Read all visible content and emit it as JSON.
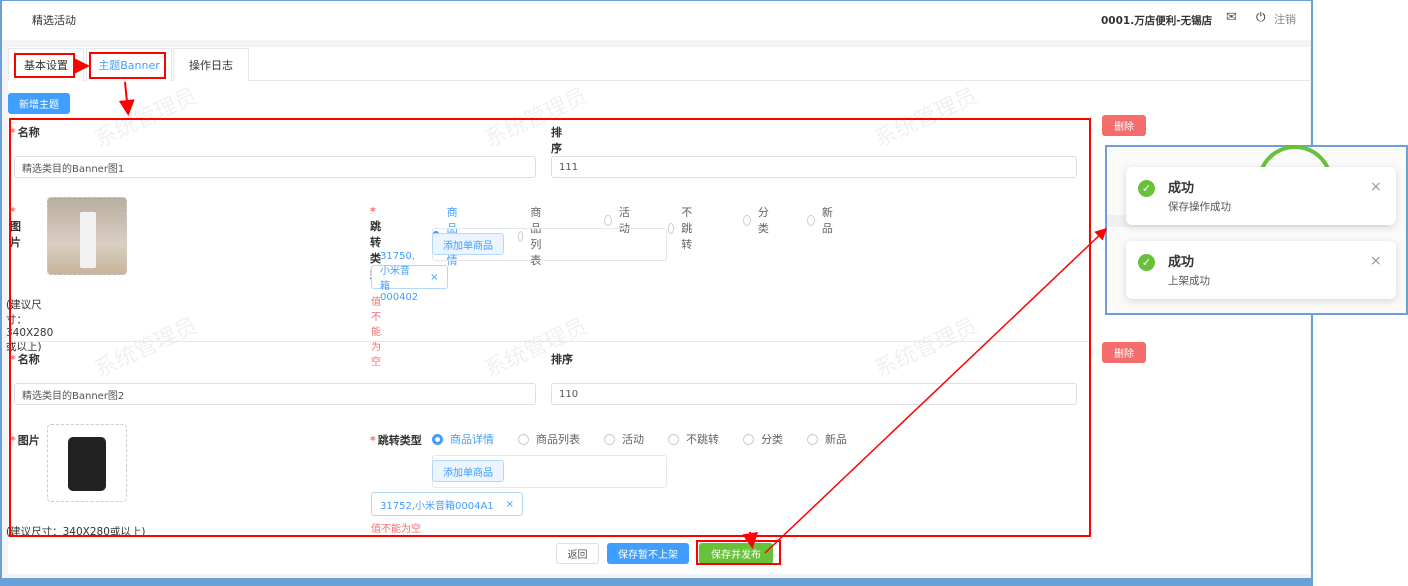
{
  "header": {
    "title": "精选活动",
    "store": "0001.万店便利-无锡店",
    "logout": "注销"
  },
  "tabs": [
    {
      "label": "基本设置"
    },
    {
      "label": "主题Banner"
    },
    {
      "label": "操作日志"
    }
  ],
  "add_theme": "新增主题",
  "watermark": "系统管理员",
  "themes": [
    {
      "name_label": "名称",
      "sort_label": "排序",
      "name_value": "精选类目的Banner图1",
      "sort_value": "111",
      "image_label": "图片",
      "size_hint": "(建议尺寸：340X280或以上)",
      "jump_label": "跳转类型",
      "options": [
        "商品详情",
        "商品列表",
        "活动",
        "不跳转",
        "分类",
        "新品"
      ],
      "selected": 0,
      "add_product": "添加单商品",
      "tag": "31750,小米音箱000402",
      "error": "值不能为空",
      "delete": "删除"
    },
    {
      "name_label": "名称",
      "sort_label": "排序",
      "name_value": "精选类目的Banner图2",
      "sort_value": "110",
      "image_label": "图片",
      "size_hint": "(建议尺寸：340X280或以上)",
      "jump_label": "跳转类型",
      "options": [
        "商品详情",
        "商品列表",
        "活动",
        "不跳转",
        "分类",
        "新品"
      ],
      "selected": 0,
      "add_product": "添加单商品",
      "tag": "31752,小米音箱0004A1",
      "error": "值不能为空",
      "delete": "删除"
    }
  ],
  "footer": {
    "back": "返回",
    "save_draft": "保存暂不上架",
    "save_publish": "保存并发布"
  },
  "toasts": [
    {
      "title": "成功",
      "message": "保存操作成功"
    },
    {
      "title": "成功",
      "message": "上架成功"
    }
  ]
}
